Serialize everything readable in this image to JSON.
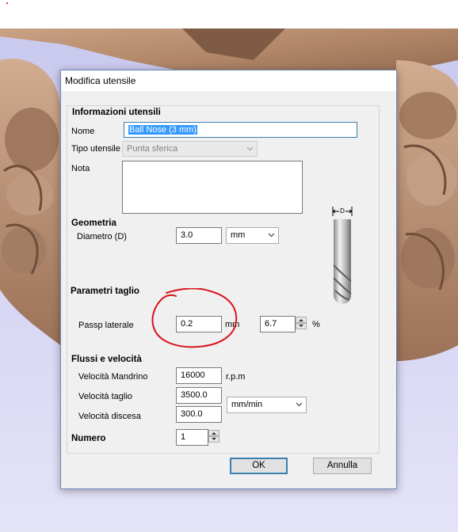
{
  "dialog": {
    "title": "Modifica utensile",
    "info": {
      "heading": "Informazioni utensili",
      "name_label": "Nome",
      "name_value": "Ball Nose (3 mm)",
      "type_label": "Tipo utensile",
      "type_value": "Punta sferica",
      "note_label": "Nota",
      "note_value": ""
    },
    "geometry": {
      "heading": "Geometria",
      "diameter_label": "Diametro (D)",
      "diameter_value": "3.0",
      "unit_value": "mm",
      "diagram_label": "D"
    },
    "cutting": {
      "heading": "Parametri taglio",
      "stepover_label": "Passp laterale",
      "stepover_value": "0.2",
      "stepover_unit": "mm",
      "stepover_percent_value": "6.7",
      "percent_sign": "%"
    },
    "feeds": {
      "heading": "Flussi e velocità",
      "spindle_label": "Velocità Mandrino",
      "spindle_value": "16000",
      "spindle_unit": "r.p.m",
      "feed_label": "Velocità taglio",
      "feed_value": "3500.0",
      "plunge_label": "Velocità discesa",
      "plunge_value": "300.0",
      "rate_unit_value": "mm/min"
    },
    "number": {
      "label": "Numero",
      "value": "1"
    },
    "buttons": {
      "ok": "OK",
      "cancel": "Annulla"
    }
  },
  "colors": {
    "accent": "#3c7fb1",
    "annotation": "#d8131e",
    "background": "#cfcef0",
    "wood": "#b88f6f"
  }
}
